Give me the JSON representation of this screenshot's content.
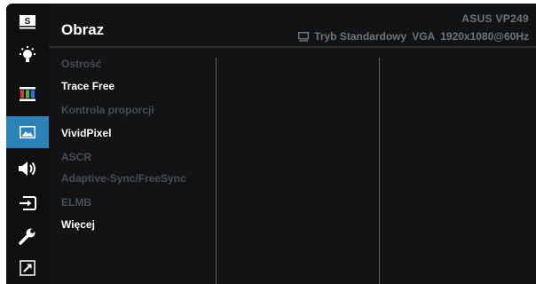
{
  "header": {
    "title": "Obraz",
    "model": "ASUS  VP249",
    "mode": "Tryb Standardowy",
    "input": "VGA",
    "resolution": "1920x1080@60Hz"
  },
  "rail": {
    "items": [
      {
        "name": "splendid",
        "label": "S",
        "active": false
      },
      {
        "name": "blue-light-filter",
        "active": false
      },
      {
        "name": "color",
        "active": false
      },
      {
        "name": "image",
        "active": true
      },
      {
        "name": "sound",
        "active": false
      },
      {
        "name": "input-select",
        "active": false
      },
      {
        "name": "system-setup",
        "active": false
      },
      {
        "name": "shortcut",
        "active": false
      }
    ]
  },
  "menu": {
    "items": [
      {
        "label": "Ostrość",
        "enabled": false
      },
      {
        "label": "Trace Free",
        "enabled": true
      },
      {
        "label": "Kontrola proporcji",
        "enabled": false
      },
      {
        "label": "VividPixel",
        "enabled": true
      },
      {
        "label": "ASCR",
        "enabled": false
      },
      {
        "label": "Adaptive-Sync/FreeSync",
        "enabled": false
      },
      {
        "label": "ELMB",
        "enabled": false
      },
      {
        "label": "Więcej",
        "enabled": true
      }
    ]
  },
  "colors": {
    "background": "#111315",
    "accent": "#2a82b8",
    "enabled_text": "#ffffff",
    "disabled_text": "#4a4e52",
    "header_text": "#6f7478"
  }
}
